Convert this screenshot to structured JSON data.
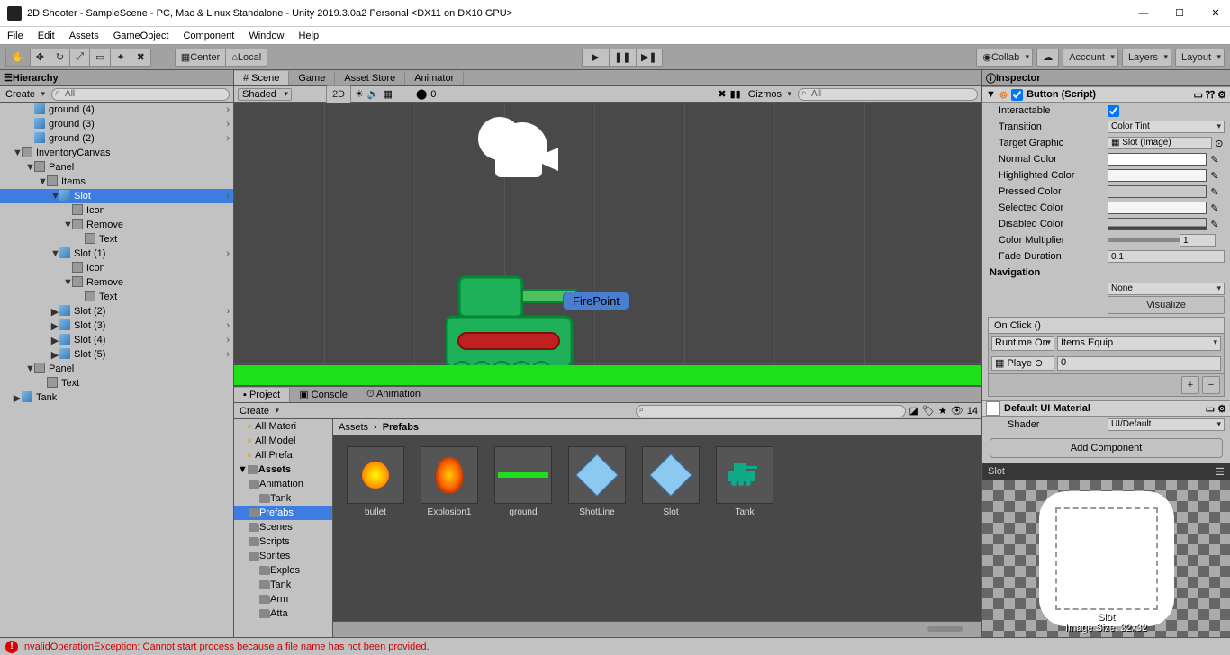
{
  "title": "2D Shooter - SampleScene - PC, Mac & Linux Standalone - Unity 2019.3.0a2 Personal <DX11 on DX10 GPU>",
  "menu": [
    "File",
    "Edit",
    "Assets",
    "GameObject",
    "Component",
    "Window",
    "Help"
  ],
  "toolbar": {
    "center": "Center",
    "local": "Local",
    "collab": "Collab",
    "account": "Account",
    "layers": "Layers",
    "layout": "Layout"
  },
  "hierarchy": {
    "title": "Hierarchy",
    "create": "Create",
    "searchPh": "All",
    "items": [
      {
        "t": "ground (4)",
        "d": 2,
        "ico": "cube",
        "arr": true
      },
      {
        "t": "ground (3)",
        "d": 2,
        "ico": "cube",
        "arr": true
      },
      {
        "t": "ground (2)",
        "d": 2,
        "ico": "cube",
        "arr": true
      },
      {
        "t": "InventoryCanvas",
        "d": 1,
        "ico": "box",
        "tgl": "▼"
      },
      {
        "t": "Panel",
        "d": 2,
        "ico": "box",
        "tgl": "▼"
      },
      {
        "t": "Items",
        "d": 3,
        "ico": "box",
        "tgl": "▼"
      },
      {
        "t": "Slot",
        "d": 4,
        "ico": "cube",
        "tgl": "▼",
        "sel": true,
        "arr": true
      },
      {
        "t": "Icon",
        "d": 5,
        "ico": "box"
      },
      {
        "t": "Remove",
        "d": 5,
        "ico": "box",
        "tgl": "▼"
      },
      {
        "t": "Text",
        "d": 6,
        "ico": "box"
      },
      {
        "t": "Slot (1)",
        "d": 4,
        "ico": "cube",
        "tgl": "▼",
        "arr": true
      },
      {
        "t": "Icon",
        "d": 5,
        "ico": "box"
      },
      {
        "t": "Remove",
        "d": 5,
        "ico": "box",
        "tgl": "▼"
      },
      {
        "t": "Text",
        "d": 6,
        "ico": "box"
      },
      {
        "t": "Slot (2)",
        "d": 4,
        "ico": "cube",
        "tgl": "▶",
        "arr": true
      },
      {
        "t": "Slot (3)",
        "d": 4,
        "ico": "cube",
        "tgl": "▶",
        "arr": true
      },
      {
        "t": "Slot (4)",
        "d": 4,
        "ico": "cube",
        "tgl": "▶",
        "arr": true
      },
      {
        "t": "Slot (5)",
        "d": 4,
        "ico": "cube",
        "tgl": "▶",
        "arr": true
      },
      {
        "t": "Panel",
        "d": 2,
        "ico": "box",
        "tgl": "▼"
      },
      {
        "t": "Text",
        "d": 3,
        "ico": "box"
      },
      {
        "t": "Tank",
        "d": 1,
        "ico": "cube",
        "tgl": "▶"
      }
    ]
  },
  "scene": {
    "tabs": [
      "Scene",
      "Game",
      "Asset Store",
      "Animator"
    ],
    "shaded": "Shaded",
    "mode2d": "2D",
    "gizmos": "Gizmos",
    "firepoint": "FirePoint",
    "zero": "0"
  },
  "project": {
    "tabs": [
      "Project",
      "Console",
      "Animation"
    ],
    "create": "Create",
    "countLabel": "14",
    "treeTop": [
      "All Materi",
      "All Model",
      "All Prefa"
    ],
    "assetsLabel": "Assets",
    "folders": [
      "Animation",
      "Tank",
      "Prefabs",
      "Scenes",
      "Scripts",
      "Sprites",
      "Explos",
      "Tank",
      "Arm",
      "Atta"
    ],
    "breadcrumb": [
      "Assets",
      "Prefabs"
    ],
    "assets": [
      "bullet",
      "Explosion1",
      "ground",
      "ShotLine",
      "Slot",
      "Tank"
    ]
  },
  "inspector": {
    "title": "Inspector",
    "component": "Button (Script)",
    "rows": [
      {
        "lbl": "Interactable",
        "type": "check",
        "val": true
      },
      {
        "lbl": "Transition",
        "type": "drop",
        "val": "Color Tint"
      },
      {
        "lbl": "Target Graphic",
        "type": "obj",
        "val": "Slot (Image)"
      },
      {
        "lbl": "Normal Color",
        "type": "color",
        "val": "#ffffff"
      },
      {
        "lbl": "Highlighted Color",
        "type": "color",
        "val": "#f5f5f5"
      },
      {
        "lbl": "Pressed Color",
        "type": "color",
        "val": "#c8c8c8"
      },
      {
        "lbl": "Selected Color",
        "type": "color",
        "val": "#f5f5f5"
      },
      {
        "lbl": "Disabled Color",
        "type": "color2",
        "val": "#c8c8c8"
      },
      {
        "lbl": "Color Multiplier",
        "type": "slider",
        "val": "1"
      },
      {
        "lbl": "Fade Duration",
        "type": "text",
        "val": "0.1"
      }
    ],
    "nav": "Navigation",
    "navVal": "None",
    "visualize": "Visualize",
    "onclick": "On Click ()",
    "runtime": "Runtime On",
    "func": "Items.Equip",
    "obj": "Playe",
    "arg": "0",
    "material": "Default UI Material",
    "shaderLbl": "Shader",
    "shader": "UI/Default",
    "addComp": "Add Component",
    "previewLbl": "Slot",
    "previewName": "Slot",
    "previewSize": "Image Size: 32x32"
  },
  "error": "InvalidOperationException: Cannot start process because a file name has not been provided."
}
